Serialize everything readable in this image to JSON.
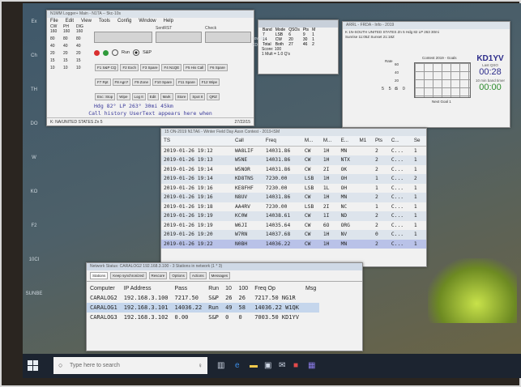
{
  "desktop": {
    "icons": [
      "Ex",
      "Ch",
      "TH",
      "DO",
      "W",
      "KO",
      "F2",
      "10CI",
      "SUNBE"
    ]
  },
  "main_window": {
    "title": "N1MM Logger+ Main - N1TA -- 5kc-10s",
    "menu": [
      "File",
      "Edit",
      "View",
      "Tools",
      "Config",
      "Window",
      "Help"
    ],
    "band_headers": [
      "CW",
      "PH",
      "DIG"
    ],
    "band_rows": [
      [
        "160",
        "160",
        "160"
      ],
      [
        "80",
        "80",
        "80"
      ],
      [
        "40",
        "40",
        "40"
      ],
      [
        "20",
        "20",
        "20"
      ],
      [
        "15",
        "15",
        "15"
      ],
      [
        "10",
        "10",
        "10"
      ]
    ],
    "field_labels": {
      "call": "",
      "sent": "SentRST",
      "rcvd": "Check"
    },
    "mode_run": "Run",
    "mode_sp": "S&P",
    "fkeys_row1": [
      "F1 S&P CQ",
      "F2 Exch",
      "F3 Spare",
      "F4 N1QE",
      "F5 His Call",
      "F6 Spare"
    ],
    "fkeys_row2": [
      "F7 Rpt",
      "F8 Agn?",
      "F9 Zone",
      "F10 Spare",
      "F11 Spare",
      "F12 Wipe"
    ],
    "actions": [
      "Esc: Stop",
      "Wipe",
      "Log It",
      "Edit",
      "Mark",
      "Store",
      "Spot It",
      "QRZ"
    ],
    "heading_text": "Hdg  82°  LP 263°  30mi  45km",
    "history_text": "Call history UserText appears here when",
    "status_left": "K: NA/UNITED STATES Zn 5",
    "status_time": "27/22/15"
  },
  "score_window": {
    "title": "",
    "columns": [
      "Band",
      "Mode",
      "QSOs",
      "Pts",
      "M"
    ],
    "rows": [
      [
        "7",
        "LSB",
        "6",
        "9",
        "1"
      ],
      [
        "14",
        "CW",
        "20",
        "30",
        "1"
      ]
    ],
    "total": [
      "Total",
      "Both",
      "27",
      "46",
      "2"
    ],
    "score": "Score: 100",
    "formula": "1 Mult = 1.0 Q's"
  },
  "edge_labels": [
    "LoveMe",
    "KD"
  ],
  "info_window": {
    "title": "ARRL - FRDA - Info - 2019",
    "line1": "K 1N-SOUTH UNITED STATES  Zn 5  Hdg 82  LP 263  30mi",
    "line2": "Sunrise 11:05Z Sunset 21:18Z",
    "rate_label": "Rate",
    "axis_values": [
      "60",
      "40",
      "20",
      "0"
    ],
    "grid_label": "Contest 2019 - Goals",
    "digits": "5 5 5 0",
    "callsign": "KD1YV",
    "last_qso_label": "Last QSO",
    "last_qso": "00:28",
    "timer_label": "10 min band timer",
    "timer": "00:00",
    "footer": "Next Goal 1"
  },
  "log_window": {
    "title": "15 ON-2019 N1TA6 - Winter Field Day Assn Contest - 2019-ISM",
    "columns": [
      "TS",
      "Call",
      "Freq",
      "M...",
      "M...",
      "E...",
      "M1",
      "Pts",
      "C...",
      "Se"
    ],
    "rows": [
      [
        "2019-01-26 19:12",
        "WA8LIF",
        "14031.86",
        "CW",
        "1H",
        "MN",
        "",
        "2",
        "C...",
        "1"
      ],
      [
        "2019-01-26 19:13",
        "W5NE",
        "14031.86",
        "CW",
        "1H",
        "NTX",
        "",
        "2",
        "C...",
        "1"
      ],
      [
        "2019-01-26 19:14",
        "W5NOR",
        "14031.86",
        "CW",
        "2I",
        "OK",
        "",
        "2",
        "C...",
        "1"
      ],
      [
        "2019-01-26 19:14",
        "KD8TNS",
        "7230.00",
        "LSB",
        "1H",
        "OH",
        "",
        "1",
        "C...",
        "2"
      ],
      [
        "2019-01-26 19:16",
        "KE8FHF",
        "7230.00",
        "LSB",
        "1L",
        "OH",
        "",
        "1",
        "C...",
        "1"
      ],
      [
        "2019-01-26 19:16",
        "N8UV",
        "14031.86",
        "CW",
        "1H",
        "MN",
        "",
        "2",
        "C...",
        "1"
      ],
      [
        "2019-01-26 19:18",
        "AA4RV",
        "7230.00",
        "LSB",
        "2I",
        "NC",
        "",
        "1",
        "C...",
        "1"
      ],
      [
        "2019-01-26 19:19",
        "KC0W",
        "14038.61",
        "CW",
        "1I",
        "ND",
        "",
        "2",
        "C...",
        "1"
      ],
      [
        "2019-01-26 19:19",
        "W6JI",
        "14035.64",
        "CW",
        "6O",
        "ORG",
        "",
        "2",
        "C...",
        "1"
      ],
      [
        "2019-01-26 19:20",
        "W7RN",
        "14037.68",
        "CW",
        "1H",
        "NV",
        "",
        "0",
        "C...",
        "1"
      ],
      [
        "2019-01-26 19:22",
        "N0BH",
        "14036.22",
        "CW",
        "1H",
        "MN",
        "",
        "2",
        "C...",
        "1"
      ]
    ]
  },
  "net_window": {
    "title": "Network Status: CARALOG2 192.168.3.100 - 3 Stations in network  (1 * 3)",
    "tabs": [
      "Stations",
      "Keep synchronized",
      "Rescore",
      "Options",
      "Actions",
      "Messages"
    ],
    "columns": [
      "Computer",
      "IP Address",
      "Pass",
      "Run",
      "10",
      "100",
      "Freq Op",
      "Msg"
    ],
    "rows": [
      [
        "CARALOG2",
        "192.168.3.100",
        "7217.50",
        "S&P",
        "26",
        "26",
        "7217.50 NG1R",
        ""
      ],
      [
        "CARALOG1",
        "192.168.3.101",
        "14036.22",
        "Run",
        "49",
        "58",
        "14036.22 W1QK",
        ""
      ],
      [
        "CARALOG3",
        "192.168.3.102",
        "0.00",
        "S&P",
        "0",
        "0",
        "7003.50 KD1YV",
        ""
      ]
    ]
  },
  "taskbar": {
    "search_placeholder": "Type here to search"
  },
  "colors": {
    "accent": "#7080d8",
    "selected_row": "#b9c2e8",
    "title_text": "#4a4a9a"
  }
}
